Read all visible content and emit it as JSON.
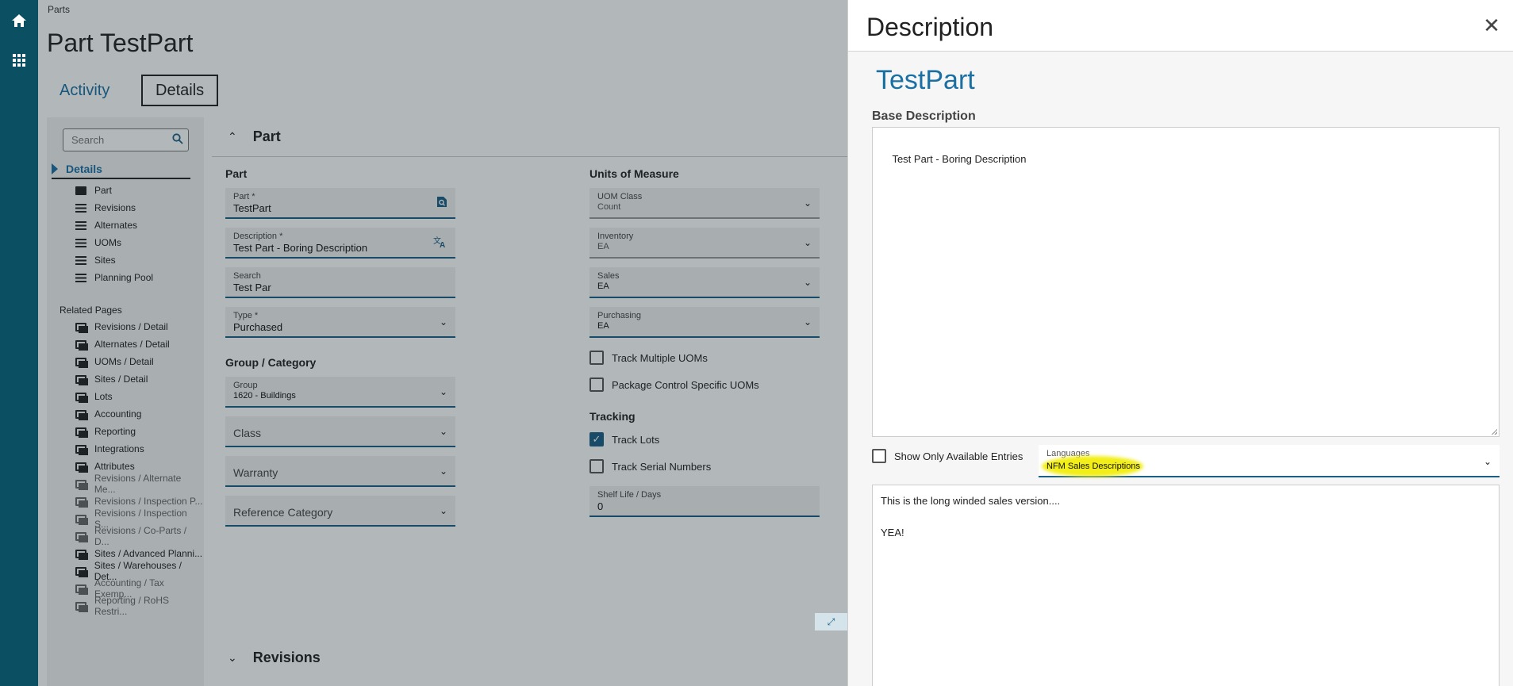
{
  "rail": {
    "home_icon": "home-icon",
    "apps_icon": "apps-grid-icon"
  },
  "breadcrumb": "Parts",
  "page_title": "Part TestPart",
  "tabs": [
    {
      "label": "Activity"
    },
    {
      "label": "Details"
    }
  ],
  "leftnav": {
    "search_placeholder": "Search",
    "details_label": "Details",
    "items": [
      {
        "label": "Part",
        "icon": "card-icon"
      },
      {
        "label": "Revisions",
        "icon": "list-icon"
      },
      {
        "label": "Alternates",
        "icon": "list-icon"
      },
      {
        "label": "UOMs",
        "icon": "list-icon"
      },
      {
        "label": "Sites",
        "icon": "list-icon"
      },
      {
        "label": "Planning Pool",
        "icon": "list-icon"
      }
    ],
    "related_heading": "Related Pages",
    "related": [
      {
        "label": "Revisions / Detail",
        "dim": false
      },
      {
        "label": "Alternates / Detail",
        "dim": false
      },
      {
        "label": "UOMs / Detail",
        "dim": false
      },
      {
        "label": "Sites / Detail",
        "dim": false
      },
      {
        "label": "Lots",
        "dim": false
      },
      {
        "label": "Accounting",
        "dim": false
      },
      {
        "label": "Reporting",
        "dim": false
      },
      {
        "label": "Integrations",
        "dim": false
      },
      {
        "label": "Attributes",
        "dim": false
      },
      {
        "label": "Revisions / Alternate Me...",
        "dim": true
      },
      {
        "label": "Revisions / Inspection P...",
        "dim": true
      },
      {
        "label": "Revisions / Inspection S...",
        "dim": true
      },
      {
        "label": "Revisions / Co-Parts / D...",
        "dim": true
      },
      {
        "label": "Sites / Advanced Planni...",
        "dim": false
      },
      {
        "label": "Sites / Warehouses / Det...",
        "dim": false
      },
      {
        "label": "Accounting / Tax Exemp...",
        "dim": true
      },
      {
        "label": "Reporting / RoHS Restri...",
        "dim": true
      }
    ]
  },
  "part_panel": {
    "header": "Part",
    "part_section": "Part",
    "part": {
      "label": "Part *",
      "value": "TestPart"
    },
    "description": {
      "label": "Description *",
      "value": "Test Part - Boring Description"
    },
    "search": {
      "label": "Search",
      "value": "Test Par"
    },
    "type": {
      "label": "Type *",
      "value": "Purchased"
    },
    "group_section": "Group / Category",
    "group": {
      "label": "Group",
      "value": "1620 - Buildings"
    },
    "class_placeholder": "Class",
    "warranty_placeholder": "Warranty",
    "reference_category_placeholder": "Reference Category",
    "uom_section": "Units of Measure",
    "uom_class": {
      "label": "UOM Class",
      "value": "Count"
    },
    "inventory": {
      "label": "Inventory",
      "value": "EA"
    },
    "sales": {
      "label": "Sales",
      "value": "EA"
    },
    "purchasing": {
      "label": "Purchasing",
      "value": "EA"
    },
    "track_multiple_uoms": {
      "label": "Track Multiple UOMs",
      "checked": false
    },
    "package_control": {
      "label": "Package Control Specific UOMs",
      "checked": false
    },
    "tracking_section": "Tracking",
    "track_lots": {
      "label": "Track Lots",
      "checked": true
    },
    "track_serial": {
      "label": "Track Serial Numbers",
      "checked": false
    },
    "shelf_life": {
      "label": "Shelf Life / Days",
      "value": "0"
    }
  },
  "revisions_header": "Revisions",
  "drawer": {
    "title": "Description",
    "part_name": "TestPart",
    "base_label": "Base Description",
    "base_text": "Test Part - Boring Description",
    "show_only_available": "Show Only Available Entries",
    "languages": {
      "label": "Languages",
      "value": "NFM Sales Descriptions"
    },
    "lang_text": "This is the long winded sales version....\n\nYEA!",
    "highlight_color": "#f2ee16"
  },
  "colors": {
    "rail": "#0b4f63",
    "accent": "#1a6fa3",
    "field_border": "#1a5f85"
  }
}
